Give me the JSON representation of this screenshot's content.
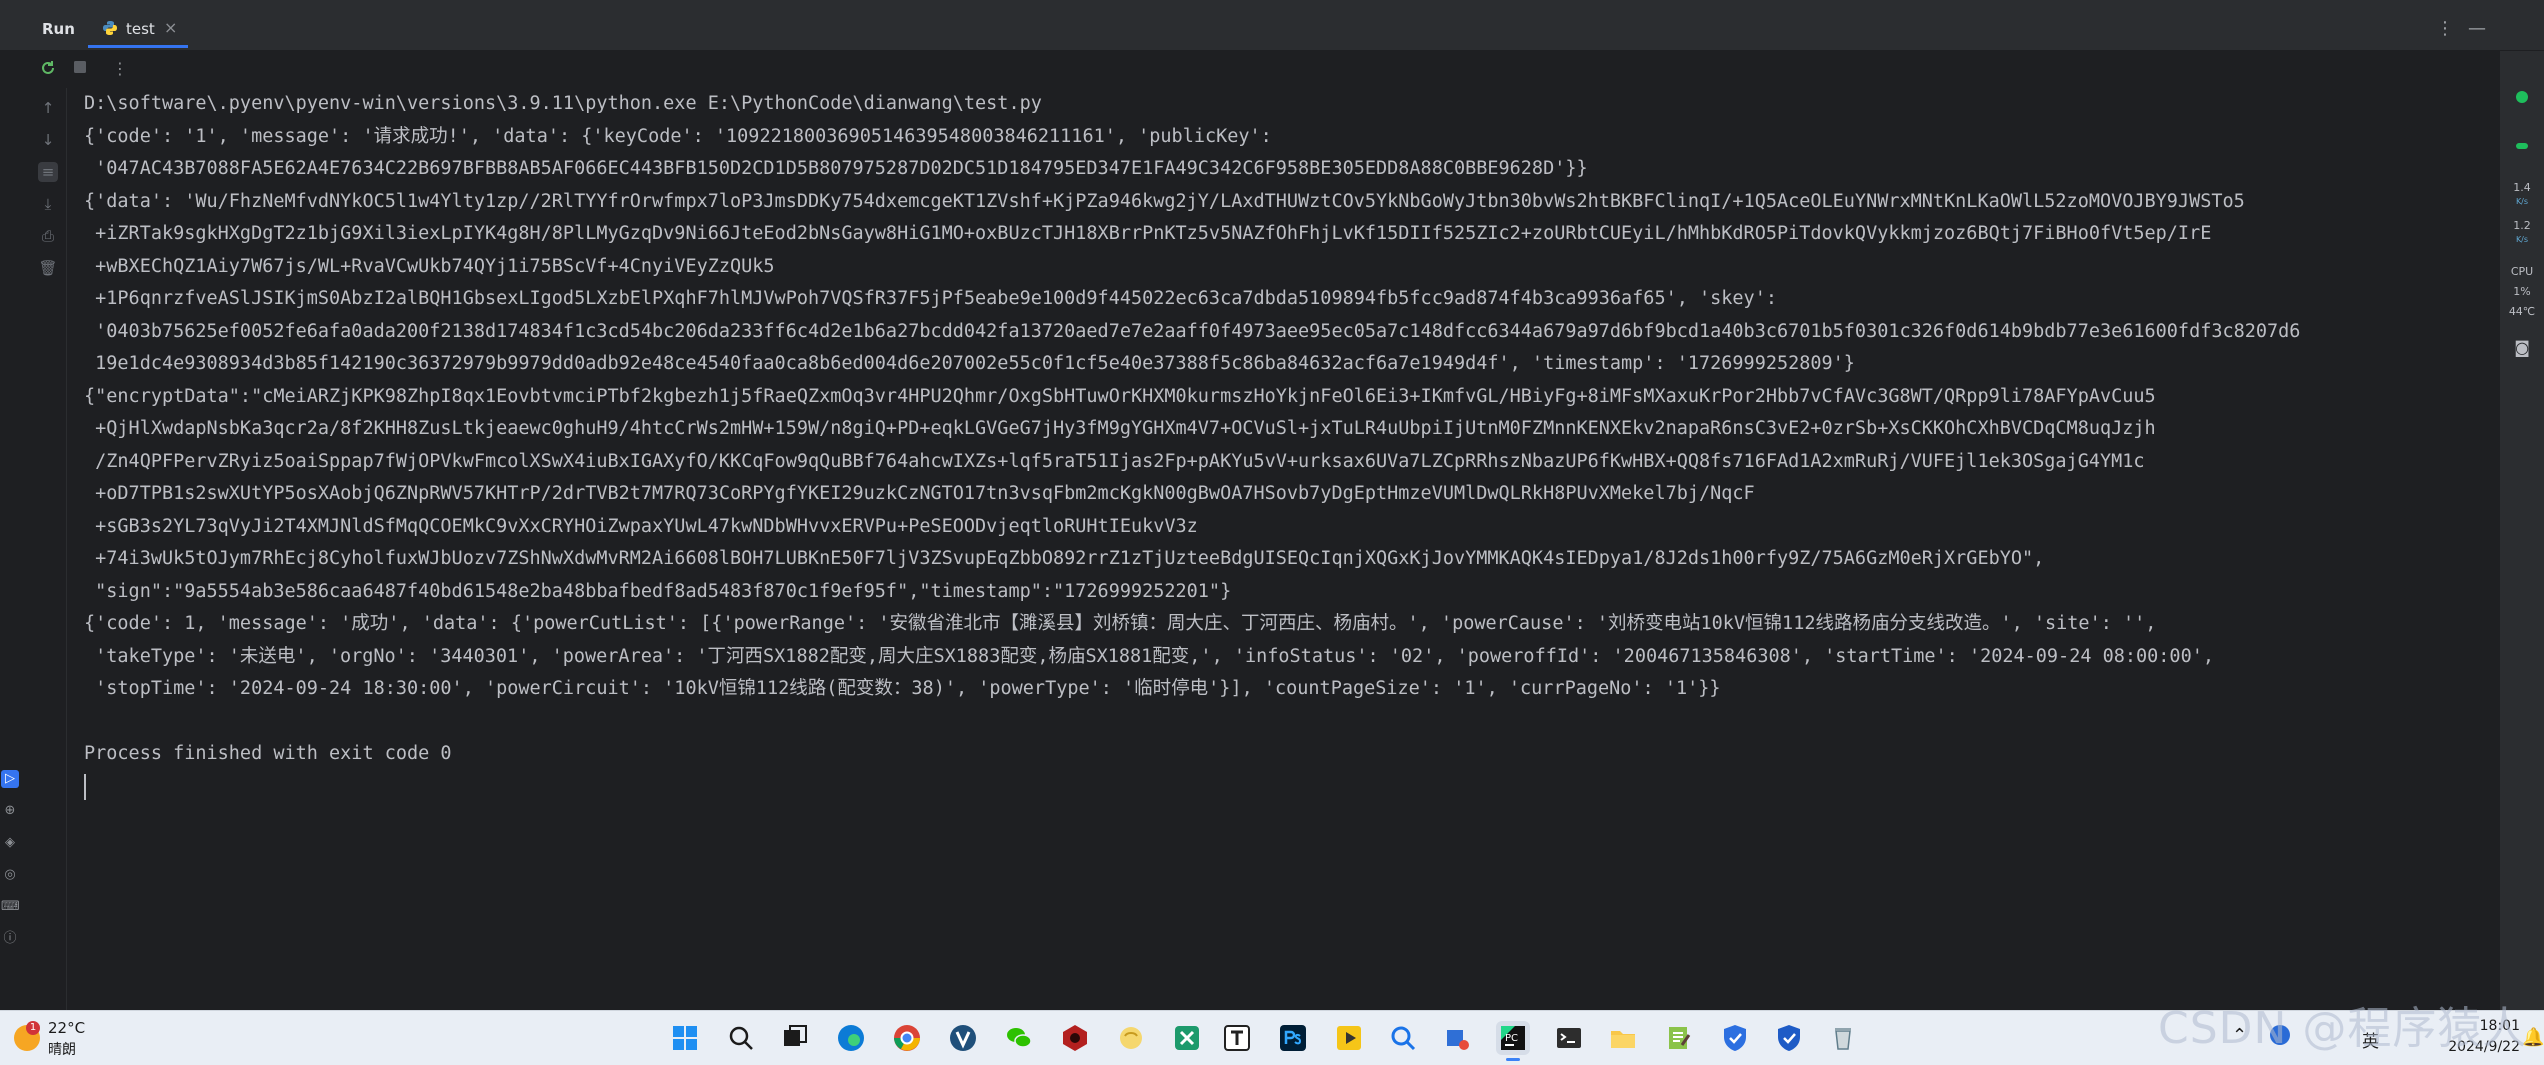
{
  "run_bar": {
    "title": "Run",
    "tab_label": "test",
    "tab_close": "×",
    "more": "⋮",
    "minimize": "—"
  },
  "console": {
    "lines": [
      "D:\\software\\.pyenv\\pyenv-win\\versions\\3.9.11\\python.exe E:\\PythonCode\\dianwang\\test.py",
      "{'code': '1', 'message': '请求成功!', 'data': {'keyCode': '1092218003690514639548003846211161', 'publicKey':",
      " '047AC43B7088FA5E62A4E7634C22B697BFBB8AB5AF066EC443BFB150D2CD1D5B807975287D02DC51D184795ED347E1FA49C342C6F958BE305EDD8A88C0BBE9628D'}}",
      "{'data': 'Wu/FhzNeMfvdNYkOC5l1w4Ylty1zp//2RlTYYfrOrwfmpx7loP3JmsDDKy754dxemcgeKT1ZVshf+KjPZa946kwg2jY/LAxdTHUWztCOv5YkNbGoWyJtbn30bvWs2htBKBFClinqI/+1Q5AceOLEuYNWrxMNtKnLKaOWlL52zoMOVOJBY9JWSTo5",
      " +iZRTak9sgkHXgDgT2z1bjG9Xil3iexLpIYK4g8H/8PlLMyGzqDv9Ni66JteEod2bNsGayw8HiG1MO+oxBUzcTJH18XBrrPnKTz5v5NAZfOhFhjLvKf15DIIf525ZIc2+zoURbtCUEyiL/hMhbKdRO5PiTdovkQVykkmjzoz6BQtj7FiBHo0fVt5ep/IrE",
      " +wBXEChQZ1Aiy7W67js/WL+RvaVCwUkb74QYj1i75BScVf+4CnyiVEyZzQUk5",
      " +1P6qnrzfveASlJSIKjmS0AbzI2alBQH1GbsexLIgod5LXzbElPXqhF7hlMJVwPoh7VQSfR37F5jPf5eabe9e100d9f445022ec63ca7dbda5109894fb5fcc9ad874f4b3ca9936af65', 'skey':",
      " '0403b75625ef0052fe6afa0ada200f2138d174834f1c3cd54bc206da233ff6c4d2e1b6a27bcdd042fa13720aed7e7e2aaff0f4973aee95ec05a7c148dfcc6344a679a97d6bf9bcd1a40b3c6701b5f0301c326f0d614b9bdb77e3e61600fdf3c8207d6",
      " 19e1dc4e9308934d3b85f142190c36372979b9979dd0adb92e48ce4540faa0ca8b6ed004d6e207002e55c0f1cf5e40e37388f5c86ba84632acf6a7e1949d4f', 'timestamp': '1726999252809'}",
      "{\"encryptData\":\"cMeiARZjKPK98ZhpI8qx1EovbtvmciPTbf2kgbezh1j5fRaeQZxmOq3vr4HPU2Qhmr/OxgSbHTuwOrKHXM0kurmszHoYkjnFeOl6Ei3+IKmfvGL/HBiyFg+8iMFsMXaxuKrPor2Hbb7vCfAVc3G8WT/QRpp9li78AFYpAvCuu5",
      " +QjHlXwdapNsbKa3qcr2a/8f2KHH8ZusLtkjeaewc0ghuH9/4htcCrWs2mHW+159W/n8giQ+PD+eqkLGVGeG7jHy3fM9gYGHXm4V7+OCVuSl+jxTuLR4uUbpiIjUtnM0FZMnnKENXEkv2napaR6nsC3vE2+0zrSb+XsCKKOhCXhBVCDqCM8uqJzjh",
      " /Zn4QPFPervZRyiz5oaiSppap7fWjOPVkwFmcolXSwX4iuBxIGAXyfO/KKCqFow9qQuBBf764ahcwIXZs+lqf5raT51Ijas2Fp+pAKYu5vV+urksax6UVa7LZCpRRhszNbazUP6fKwHBX+QQ8fs716FAd1A2xmRuRj/VUFEjl1ek3OSgajG4YM1c",
      " +oD7TPB1s2swXUtYP5osXAobjQ6ZNpRWV57KHTrP/2drTVB2t7M7RQ73CoRPYgfYKEI29uzkCzNGTO17tn3vsqFbm2mcKgkN00gBwOA7HSovb7yDgEptHmzeVUMlDwQLRkH8PUvXMekel7bj/NqcF",
      " +sGB3s2YL73qVyJi2T4XMJNldSfMqQCOEMkC9vXxCRYHOiZwpaxYUwL47kwNDbWHvvxERVPu+PeSEOODvjeqtloRUHtIEukvV3z",
      " +74i3wUk5tOJym7RhEcj8CyholfuxWJbUozv7ZShNwXdwMvRM2Ai6608lBOH7LUBKnE50F7ljV3ZSvupEqZbbO892rrZ1zTjUzteeBdgUISEQcIqnjXQGxKjJovYMMKAQK4sIEDpya1/8J2ds1h00rfy9Z/75A6GzM0eRjXrGEbYO\",",
      " \"sign\":\"9a5554ab3e586caa6487f40bd61548e2ba48bbafbedf8ad5483f870c1f9ef95f\",\"timestamp\":\"1726999252201\"}",
      "{'code': 1, 'message': '成功', 'data': {'powerCutList': [{'powerRange': '安徽省淮北市【濉溪县】刘桥镇：周大庄、丁河西庄、杨庙村。', 'powerCause': '刘桥变电站10kV恒锦112线路杨庙分支线改造。', 'site': '',",
      " 'takeType': '未送电', 'orgNo': '3440301', 'powerArea': '丁河西SX1882配变,周大庄SX1883配变,杨庙SX1881配变,', 'infoStatus': '02', 'poweroffId': '200467135846308', 'startTime': '2024-09-24 08:00:00',",
      " 'stopTime': '2024-09-24 18:30:00', 'powerCircuit': '10kV恒锦112线路(配变数：38)', 'powerType': '临时停电'}], 'countPageSize': '1', 'currPageNo': '1'}}",
      "",
      "Process finished with exit code 0"
    ]
  },
  "right_panel": {
    "net_up": "1.4",
    "net_up_unit": "K/s",
    "net_down": "1.2",
    "net_down_unit": "K/s",
    "cpu_label": "CPU",
    "cpu_value": "1%",
    "cpu_temp": "44℃"
  },
  "taskbar": {
    "weather_temp": "22°C",
    "weather_cond": "晴朗",
    "weather_badge": "1",
    "ime": "英",
    "time": "18:01",
    "date": "2024/9/22",
    "apps": [
      "windows-start",
      "search",
      "task-view",
      "edge",
      "chrome",
      "vscode",
      "wechat",
      "app-red",
      "app-yellow",
      "excel",
      "typora",
      "photoshop",
      "player",
      "search-tool",
      "app-blue",
      "pycharm",
      "terminal",
      "file-explorer",
      "notepad",
      "defender",
      "defender2",
      "recycle"
    ]
  },
  "watermark": "CSDN @程序猿人",
  "colors": {
    "console_bg": "#1e1f22",
    "panel_bg": "#2b2d30",
    "text": "#bcbec4",
    "accent": "#3574f0"
  }
}
